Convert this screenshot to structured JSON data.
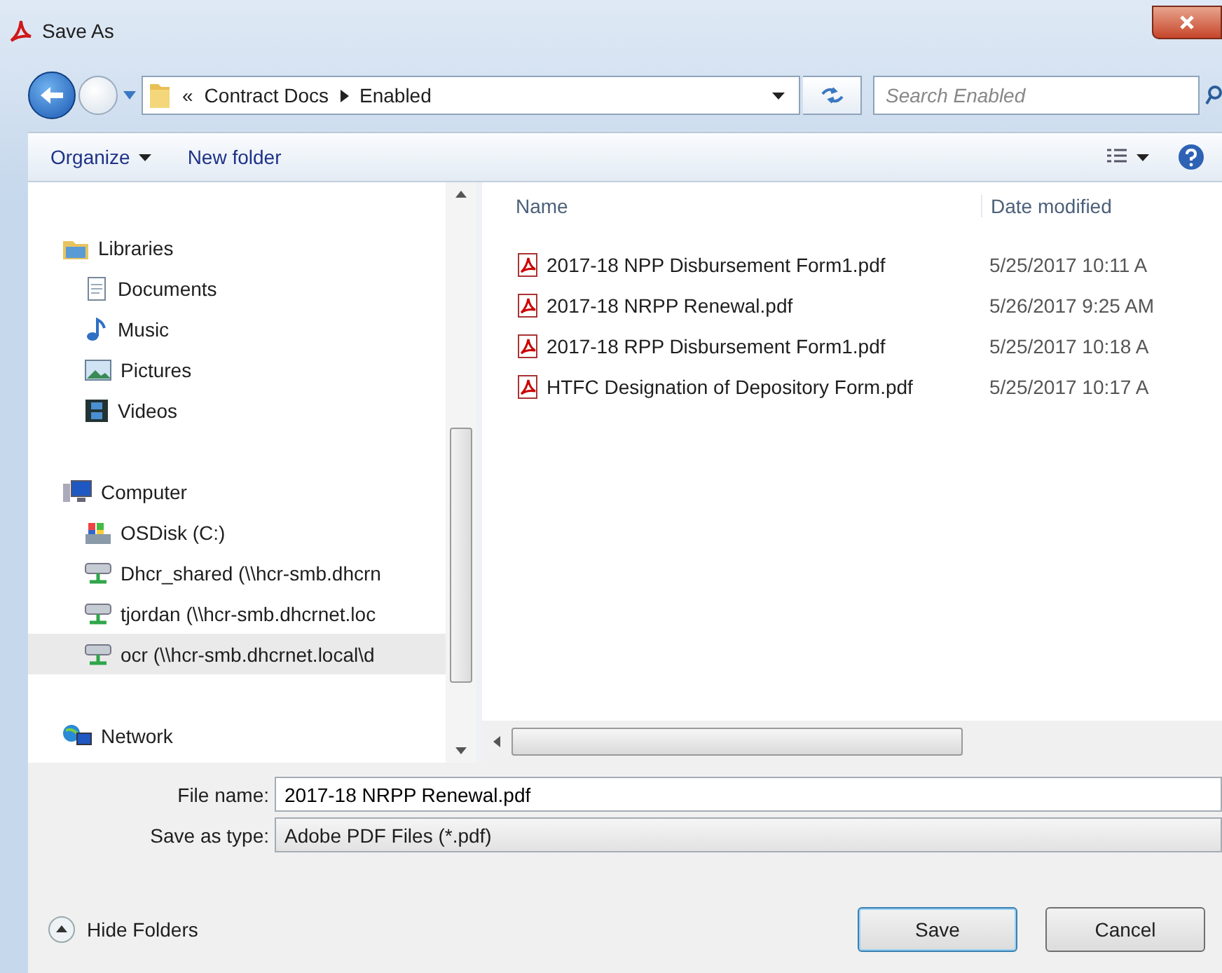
{
  "window": {
    "title": "Save As"
  },
  "address": {
    "overflow": "«",
    "path": [
      "Contract Docs",
      "Enabled"
    ]
  },
  "search": {
    "placeholder": "Search Enabled"
  },
  "toolbar": {
    "organize": "Organize",
    "new_folder": "New folder"
  },
  "navigation": [
    {
      "label": "Libraries",
      "kind": "libraries",
      "selected": false,
      "children": [
        {
          "label": "Documents",
          "kind": "documents",
          "selected": false
        },
        {
          "label": "Music",
          "kind": "music",
          "selected": false
        },
        {
          "label": "Pictures",
          "kind": "pictures",
          "selected": false
        },
        {
          "label": "Videos",
          "kind": "videos",
          "selected": false
        }
      ]
    },
    {
      "label": "Computer",
      "kind": "computer",
      "selected": false,
      "children": [
        {
          "label": "OSDisk (C:)",
          "kind": "drive",
          "selected": false
        },
        {
          "label": "Dhcr_shared (\\\\hcr-smb.dhcrn",
          "kind": "network-drive",
          "selected": false
        },
        {
          "label": "tjordan (\\\\hcr-smb.dhcrnet.loc",
          "kind": "network-drive",
          "selected": false
        },
        {
          "label": "ocr (\\\\hcr-smb.dhcrnet.local\\d",
          "kind": "network-drive",
          "selected": true
        }
      ]
    },
    {
      "label": "Network",
      "kind": "network",
      "selected": false
    }
  ],
  "columns": [
    "Name",
    "Date modified"
  ],
  "files": [
    {
      "name": "2017-18 NPP Disbursement Form1.pdf",
      "date": "5/25/2017 10:11 A"
    },
    {
      "name": "2017-18 NRPP Renewal.pdf",
      "date": "5/26/2017 9:25 AM"
    },
    {
      "name": "2017-18 RPP Disbursement Form1.pdf",
      "date": "5/25/2017 10:18 A"
    },
    {
      "name": "HTFC Designation of Depository Form.pdf",
      "date": "5/25/2017 10:17 A"
    }
  ],
  "file_name": {
    "label": "File name:",
    "value": "2017-18 NRPP Renewal.pdf"
  },
  "save_type": {
    "label": "Save as type:",
    "value": "Adobe PDF Files (*.pdf)"
  },
  "hide_folders": "Hide Folders",
  "buttons": [
    {
      "label": "Save",
      "default": true
    },
    {
      "label": "Cancel",
      "default": false
    }
  ]
}
